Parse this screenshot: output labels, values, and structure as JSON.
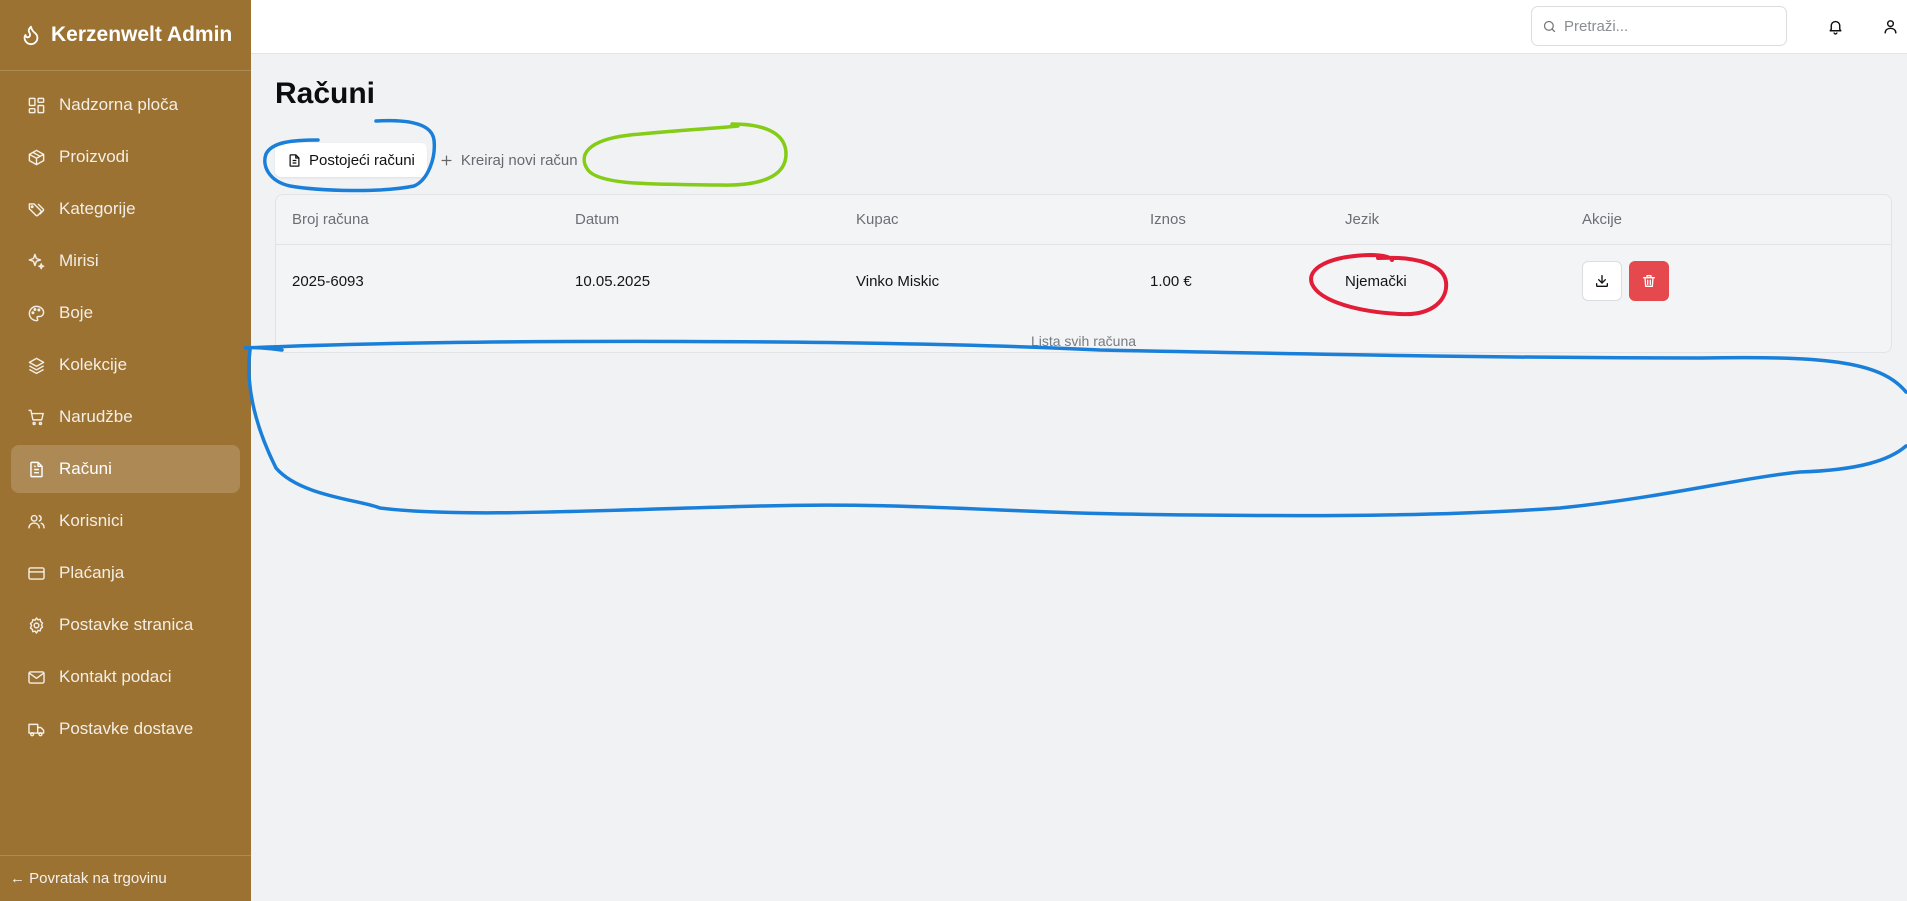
{
  "app": {
    "title": "Kerzenwelt Admin"
  },
  "sidebar": {
    "items": [
      {
        "label": "Nadzorna ploča",
        "icon": "dashboard-icon"
      },
      {
        "label": "Proizvodi",
        "icon": "box-icon"
      },
      {
        "label": "Kategorije",
        "icon": "tags-icon"
      },
      {
        "label": "Mirisi",
        "icon": "sparkles-icon"
      },
      {
        "label": "Boje",
        "icon": "palette-icon"
      },
      {
        "label": "Kolekcije",
        "icon": "layers-icon"
      },
      {
        "label": "Narudžbe",
        "icon": "cart-icon"
      },
      {
        "label": "Računi",
        "icon": "file-text-icon",
        "active": true
      },
      {
        "label": "Korisnici",
        "icon": "users-icon"
      },
      {
        "label": "Plaćanja",
        "icon": "credit-card-icon"
      },
      {
        "label": "Postavke stranica",
        "icon": "gear-icon"
      },
      {
        "label": "Kontakt podaci",
        "icon": "mail-icon"
      },
      {
        "label": "Postavke dostave",
        "icon": "truck-icon"
      }
    ],
    "back_link": "← Povratak na trgovinu"
  },
  "topbar": {
    "search_placeholder": "Pretraži..."
  },
  "page": {
    "title": "Računi",
    "tabs": [
      {
        "label": "Postojeći računi",
        "active": true
      },
      {
        "label": "Kreiraj novi račun",
        "active": false
      }
    ]
  },
  "table": {
    "headers": [
      "Broj računa",
      "Datum",
      "Kupac",
      "Iznos",
      "Jezik",
      "Akcije"
    ],
    "rows": [
      {
        "number": "2025-6093",
        "date": "10.05.2025",
        "customer": "Vinko Miskic",
        "amount": "1.00 €",
        "language": "Njemački"
      }
    ],
    "caption": "Lista svih računa"
  },
  "colors": {
    "sidebar": "#9c7233",
    "delete": "#e5484d",
    "annotation_blue": "#1a7fd8",
    "annotation_green": "#84cc16",
    "annotation_red": "#e11d38"
  }
}
